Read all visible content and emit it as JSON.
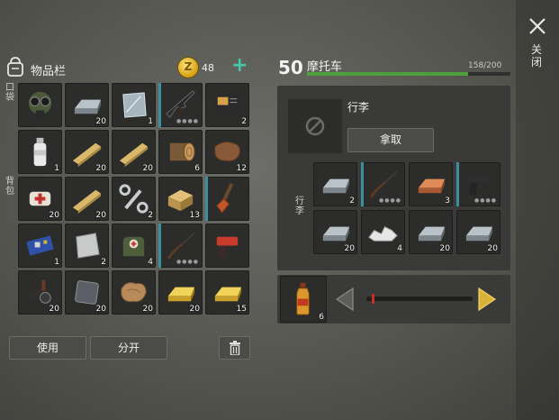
{
  "close": {
    "label": "关闭"
  },
  "inventory": {
    "title": "物品栏",
    "coins": "48",
    "pocket_label": "口袋",
    "backpack_label": "背包",
    "pocket_slots": [
      {
        "icon": "gas-mask-icon",
        "qty": "",
        "durability": false,
        "bar": false
      },
      {
        "icon": "metal-ingot-icon",
        "qty": "20",
        "durability": false,
        "bar": false
      },
      {
        "icon": "glass-pane-icon",
        "qty": "1",
        "durability": false,
        "bar": false
      },
      {
        "icon": "assault-rifle-icon",
        "qty": "",
        "durability": true,
        "bar": true
      },
      {
        "icon": "notebook-icon",
        "qty": "2",
        "durability": false,
        "bar": false
      }
    ],
    "backpack_slots": [
      {
        "icon": "spray-bottle-icon",
        "qty": "1",
        "durability": false,
        "bar": false
      },
      {
        "icon": "wooden-plank-icon",
        "qty": "20",
        "durability": false,
        "bar": false
      },
      {
        "icon": "wooden-plank-icon",
        "qty": "20",
        "durability": false,
        "bar": false
      },
      {
        "icon": "log-icon",
        "qty": "6",
        "durability": false,
        "bar": false
      },
      {
        "icon": "leather-icon",
        "qty": "12",
        "durability": false,
        "bar": false
      },
      {
        "icon": "first-aid-bandage-icon",
        "qty": "20",
        "durability": false,
        "bar": false
      },
      {
        "icon": "wooden-plank-icon",
        "qty": "20",
        "durability": false,
        "bar": false
      },
      {
        "icon": "wrench-icon",
        "qty": "2",
        "durability": false,
        "bar": false
      },
      {
        "icon": "wood-block-icon",
        "qty": "13",
        "durability": false,
        "bar": false
      },
      {
        "icon": "shovel-icon",
        "qty": "",
        "durability": false,
        "bar": true
      },
      {
        "icon": "circuit-board-icon",
        "qty": "1",
        "durability": false,
        "bar": false
      },
      {
        "icon": "metal-sheet-icon",
        "qty": "2",
        "durability": false,
        "bar": false
      },
      {
        "icon": "medical-bag-icon",
        "qty": "4",
        "durability": false,
        "bar": false
      },
      {
        "icon": "shotgun-icon",
        "qty": "",
        "durability": true,
        "bar": true
      },
      {
        "icon": "flare-gun-icon",
        "qty": "",
        "durability": false,
        "bar": false
      },
      {
        "icon": "scrap-parts-icon",
        "qty": "20",
        "durability": false,
        "bar": false
      },
      {
        "icon": "metal-plate-icon",
        "qty": "20",
        "durability": false,
        "bar": false
      },
      {
        "icon": "cloth-icon",
        "qty": "20",
        "durability": false,
        "bar": false
      },
      {
        "icon": "gold-bar-icon",
        "qty": "20",
        "durability": false,
        "bar": false
      },
      {
        "icon": "gold-bar-icon",
        "qty": "15",
        "durability": false,
        "bar": false
      }
    ],
    "use_button": "使用",
    "split_button": "分开"
  },
  "vehicle": {
    "level": "50",
    "name": "摩托车",
    "durability_text": "158/200",
    "durability_fraction": 0.79,
    "luggage_title": "行李",
    "take_button": "拿取",
    "luggage_label": "行李",
    "luggage_slots": [
      {
        "icon": "metal-ingot-icon",
        "qty": "2",
        "durability": false,
        "bar": false
      },
      {
        "icon": "shotgun-icon",
        "qty": "",
        "durability": true,
        "bar": true
      },
      {
        "icon": "copper-ingot-icon",
        "qty": "3",
        "durability": false,
        "bar": false
      },
      {
        "icon": "pistol-icon",
        "qty": "",
        "durability": true,
        "bar": true
      },
      {
        "icon": "metal-ingot-icon",
        "qty": "20",
        "durability": false,
        "bar": false
      },
      {
        "icon": "stone-icon",
        "qty": "4",
        "durability": false,
        "bar": false
      },
      {
        "icon": "metal-ingot-icon",
        "qty": "20",
        "durability": false,
        "bar": false
      },
      {
        "icon": "metal-ingot-icon",
        "qty": "20",
        "durability": false,
        "bar": false
      }
    ],
    "fuel_qty": "6",
    "fuel_slider_fraction": 0.05
  },
  "colors": {
    "accent_teal": "#43c9a8",
    "durability_green": "#4ea03e",
    "slot_bar": "#3c8f9e"
  }
}
